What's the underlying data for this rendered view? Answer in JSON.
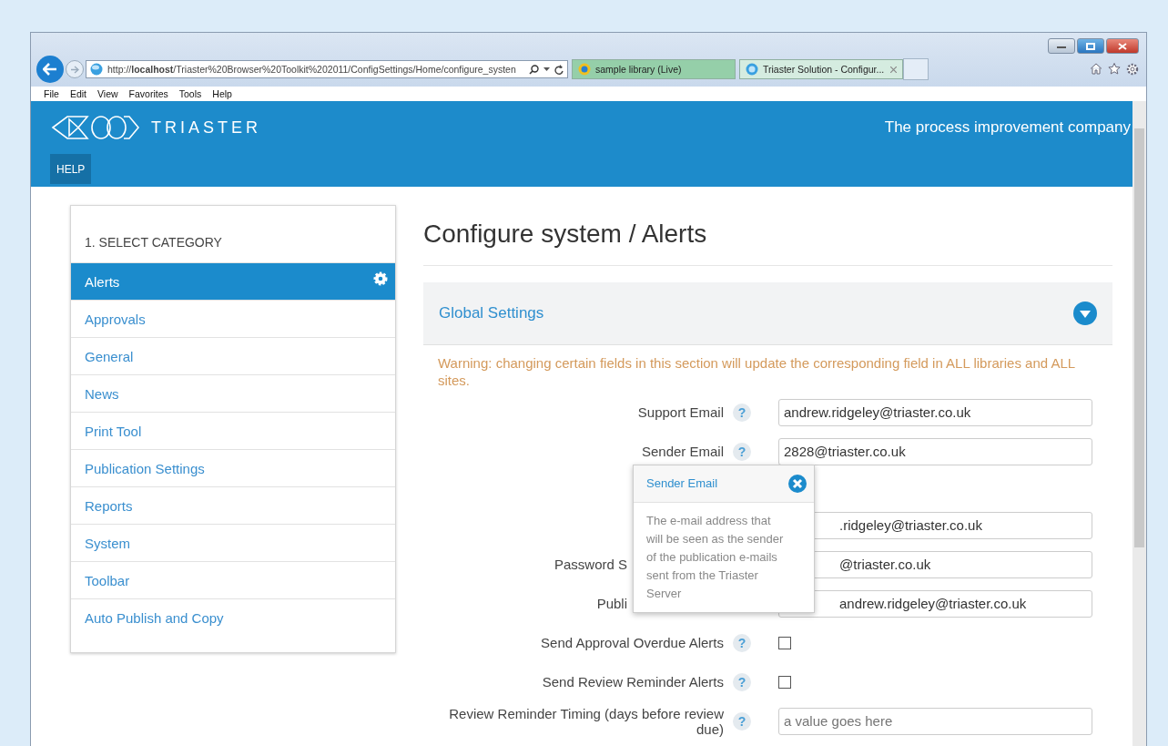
{
  "browser": {
    "address": "http://**localhost**/Triaster%20Browser%20Toolkit%202011/ConfigSettings/Home/configure_systen",
    "tabs": [
      {
        "label": "sample library (Live)",
        "selected": false,
        "closable": false
      },
      {
        "label": "Triaster Solution - Configur...",
        "selected": true,
        "closable": true
      }
    ],
    "menu": [
      "File",
      "Edit",
      "View",
      "Favorites",
      "Tools",
      "Help"
    ]
  },
  "header": {
    "brand": "TRIASTER",
    "tagline": "The process improvement company",
    "nav": [
      {
        "label": "HELP",
        "selected": true
      }
    ]
  },
  "sidebar": {
    "heading": "1. SELECT CATEGORY",
    "items": [
      {
        "label": "Alerts",
        "selected": true
      },
      {
        "label": "Approvals",
        "selected": false
      },
      {
        "label": "General",
        "selected": false
      },
      {
        "label": "News",
        "selected": false
      },
      {
        "label": "Print Tool",
        "selected": false
      },
      {
        "label": "Publication Settings",
        "selected": false
      },
      {
        "label": "Reports",
        "selected": false
      },
      {
        "label": "System",
        "selected": false
      },
      {
        "label": "Toolbar",
        "selected": false
      },
      {
        "label": "Auto Publish and Copy",
        "selected": false
      }
    ]
  },
  "main": {
    "title": "Configure system / Alerts",
    "panel": {
      "title": "Global Settings",
      "expanded": true,
      "warning": "Warning: changing certain fields in this section will update the corresponding field in ALL libraries and ALL sites.",
      "fields": [
        {
          "kind": "text",
          "label": "Support Email",
          "help": "?",
          "value": "andrew.ridgeley@triaster.co.uk"
        },
        {
          "kind": "text",
          "label": "Sender Email",
          "help": "?",
          "value": "2828@triaster.co.uk",
          "popover": {
            "title": "Sender Email",
            "text": "The e-mail address that will be seen as the sender of the publication e-mails sent from the Triaster Server"
          }
        },
        {
          "kind": "obscured",
          "value": ".ridgeley@triaster.co.uk"
        },
        {
          "kind": "obscured",
          "label": "Password S",
          "value": "@triaster.co.uk"
        },
        {
          "kind": "obscured",
          "label": "Publi",
          "value": "andrew.ridgeley@triaster.co.uk"
        },
        {
          "kind": "checkbox",
          "label": "Send Approval Overdue Alerts",
          "help": "?",
          "checked": false
        },
        {
          "kind": "checkbox",
          "label": "Send Review Reminder Alerts",
          "help": "?",
          "checked": false
        },
        {
          "kind": "text",
          "label": "Review Reminder Timing (days before review due)",
          "help": "?",
          "placeholder": "a value goes here"
        }
      ]
    }
  }
}
